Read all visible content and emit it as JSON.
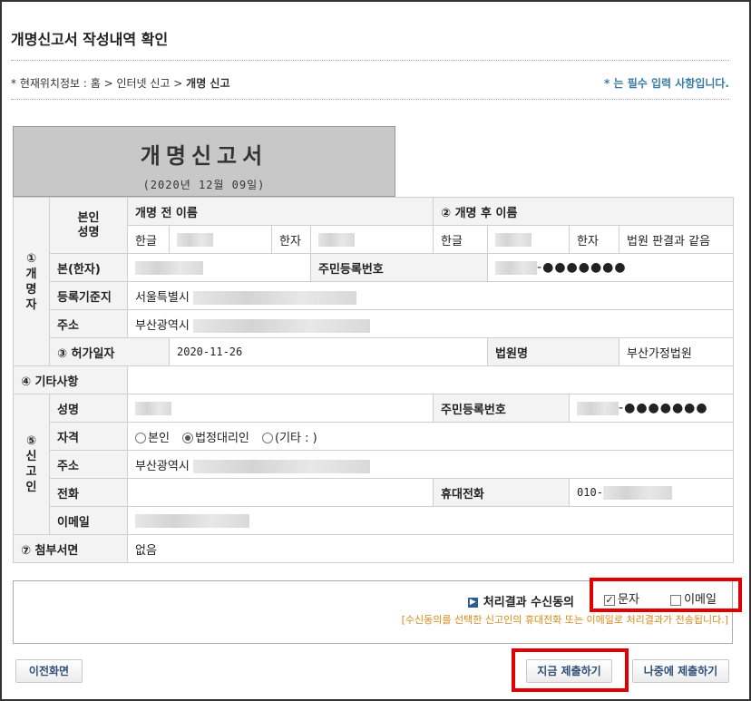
{
  "page": {
    "title": "개명신고서 작성내역 확인",
    "breadcrumb_prefix": "* 현재위치정보 : 홈 > 인터넷 신고 > ",
    "breadcrumb_current": "개명 신고",
    "required_note": "* 는 필수 입력 사항입니다."
  },
  "form": {
    "title": "개명신고서",
    "date": "(2020년 12월 09일)"
  },
  "sections": {
    "person": "①\n개\n명\n자",
    "permit_date": "③ 허가일자",
    "other": "④ 기타사항",
    "reporter": "⑤\n신\n고\n인",
    "attachments": "⑦ 첨부서면"
  },
  "labels": {
    "self_name": "본인\n성명",
    "before_name": "개명 전 이름",
    "after_name": "② 개명 후 이름",
    "hangul": "한글",
    "hanja": "한자",
    "bon": "본(한자)",
    "rrn": "주민등록번호",
    "registry": "등록기준지",
    "address": "주소",
    "court": "법원명",
    "name": "성명",
    "qualification": "자격",
    "phone": "전화",
    "mobile": "휴대전화",
    "email": "이메일"
  },
  "values": {
    "after_hanja": "법원 판결과 같음",
    "rrn_masked": "-●●●●●●●",
    "registry": "서울특별시",
    "address": "부산광역시",
    "permit_date": "2020-11-26",
    "court": "부산가정법원",
    "reporter_rrn_masked": "-●●●●●●●",
    "reporter_address": "부산광역시",
    "mobile_prefix": "010-",
    "attachments": "없음"
  },
  "qualification_options": [
    "본인",
    "법정대리인",
    "(기타 : )"
  ],
  "qualification_selected": "법정대리인",
  "consent": {
    "label": "처리결과 수신동의",
    "sms": "문자",
    "sms_checked": true,
    "email": "이메일",
    "email_checked": false,
    "note": "[수신동의를 선택한 신고인의 휴대전화 또는 이메일로 처리결과가 전송됩니다.]"
  },
  "buttons": {
    "prev": "이전화면",
    "submit_now": "지금 제출하기",
    "submit_later": "나중에 제출하기"
  },
  "colors": {
    "highlight": "#e00000",
    "accent": "#3a7ca5",
    "note": "#d48a1a"
  }
}
